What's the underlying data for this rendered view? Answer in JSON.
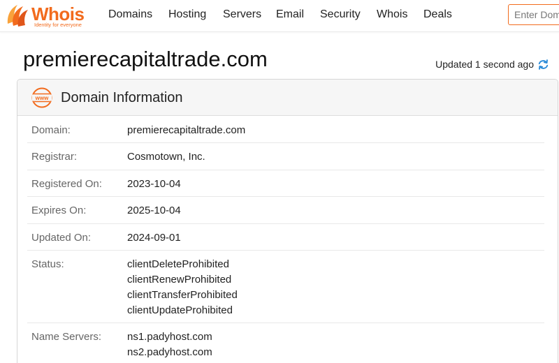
{
  "brand": {
    "name": "Whois",
    "tagline": "Identity for everyone",
    "accent_color": "#f26b1d"
  },
  "nav": {
    "items": [
      "Domains",
      "Hosting",
      "Servers",
      "Email",
      "Security",
      "Whois",
      "Deals"
    ],
    "search_placeholder": "Enter Domain"
  },
  "page": {
    "domain": "premierecapitaltrade.com",
    "updated": "Updated 1 second ago"
  },
  "card": {
    "title": "Domain Information",
    "icon": "www-icon",
    "rows": [
      {
        "label": "Domain:",
        "values": [
          "premierecapitaltrade.com"
        ]
      },
      {
        "label": "Registrar:",
        "values": [
          "Cosmotown, Inc."
        ]
      },
      {
        "label": "Registered On:",
        "values": [
          "2023-10-04"
        ]
      },
      {
        "label": "Expires On:",
        "values": [
          "2025-10-04"
        ]
      },
      {
        "label": "Updated On:",
        "values": [
          "2024-09-01"
        ]
      },
      {
        "label": "Status:",
        "values": [
          "clientDeleteProhibited",
          "clientRenewProhibited",
          "clientTransferProhibited",
          "clientUpdateProhibited"
        ]
      },
      {
        "label": "Name Servers:",
        "values": [
          "ns1.padyhost.com",
          "ns2.padyhost.com"
        ]
      }
    ]
  }
}
